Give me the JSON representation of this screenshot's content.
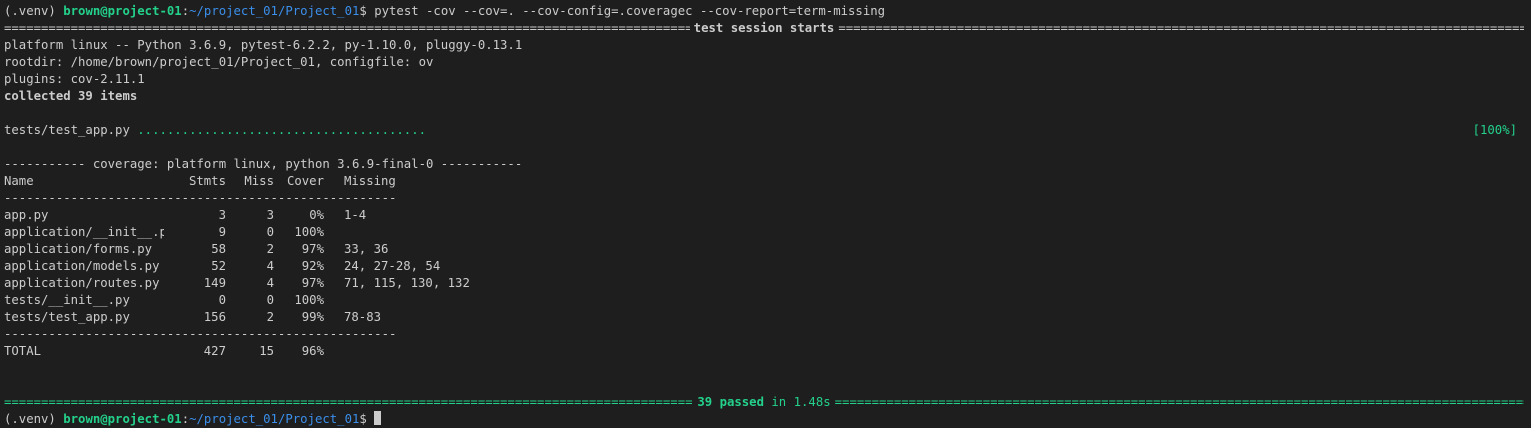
{
  "prompt": {
    "venv": "(.venv) ",
    "userhost": "brown@project-01",
    "colon": ":",
    "path": "~/project_01/Project_01",
    "dollar": "$ ",
    "command": "pytest -cov --cov=. --cov-config=.coveragec --cov-report=term-missing"
  },
  "session": {
    "header": "test session starts",
    "platform": "platform linux -- Python 3.6.9, pytest-6.2.2, py-1.10.0, pluggy-0.13.1",
    "rootdir": "rootdir: /home/brown/project_01/Project_01, configfile: ov",
    "plugins": "plugins: cov-2.11.1",
    "collected": "collected 39 items"
  },
  "progress": {
    "file": "tests/test_app.py",
    "dots": ".......................................",
    "percent": "[100%]"
  },
  "coverage": {
    "header": "----------- coverage: platform linux, python 3.6.9-final-0 -----------",
    "columns": [
      "Name",
      "Stmts",
      "Miss",
      "Cover",
      "Missing"
    ],
    "divider": "-----------------------------------------------------",
    "rows": [
      {
        "name": "app.py",
        "stmts": "3",
        "miss": "3",
        "cover": "0%",
        "missing": "1-4"
      },
      {
        "name": "application/__init__.py",
        "stmts": "9",
        "miss": "0",
        "cover": "100%",
        "missing": ""
      },
      {
        "name": "application/forms.py",
        "stmts": "58",
        "miss": "2",
        "cover": "97%",
        "missing": "33, 36"
      },
      {
        "name": "application/models.py",
        "stmts": "52",
        "miss": "4",
        "cover": "92%",
        "missing": "24, 27-28, 54"
      },
      {
        "name": "application/routes.py",
        "stmts": "149",
        "miss": "4",
        "cover": "97%",
        "missing": "71, 115, 130, 132"
      },
      {
        "name": "tests/__init__.py",
        "stmts": "0",
        "miss": "0",
        "cover": "100%",
        "missing": ""
      },
      {
        "name": "tests/test_app.py",
        "stmts": "156",
        "miss": "2",
        "cover": "99%",
        "missing": "78-83"
      }
    ],
    "total": {
      "name": "TOTAL",
      "stmts": "427",
      "miss": "15",
      "cover": "96%",
      "missing": ""
    }
  },
  "result": {
    "passed": "39 passed",
    "in": "in 1.48s"
  },
  "colors": {
    "background": "#1e1e1e",
    "foreground": "#cccccc",
    "green": "#23d18b",
    "blue": "#3b8eea"
  }
}
